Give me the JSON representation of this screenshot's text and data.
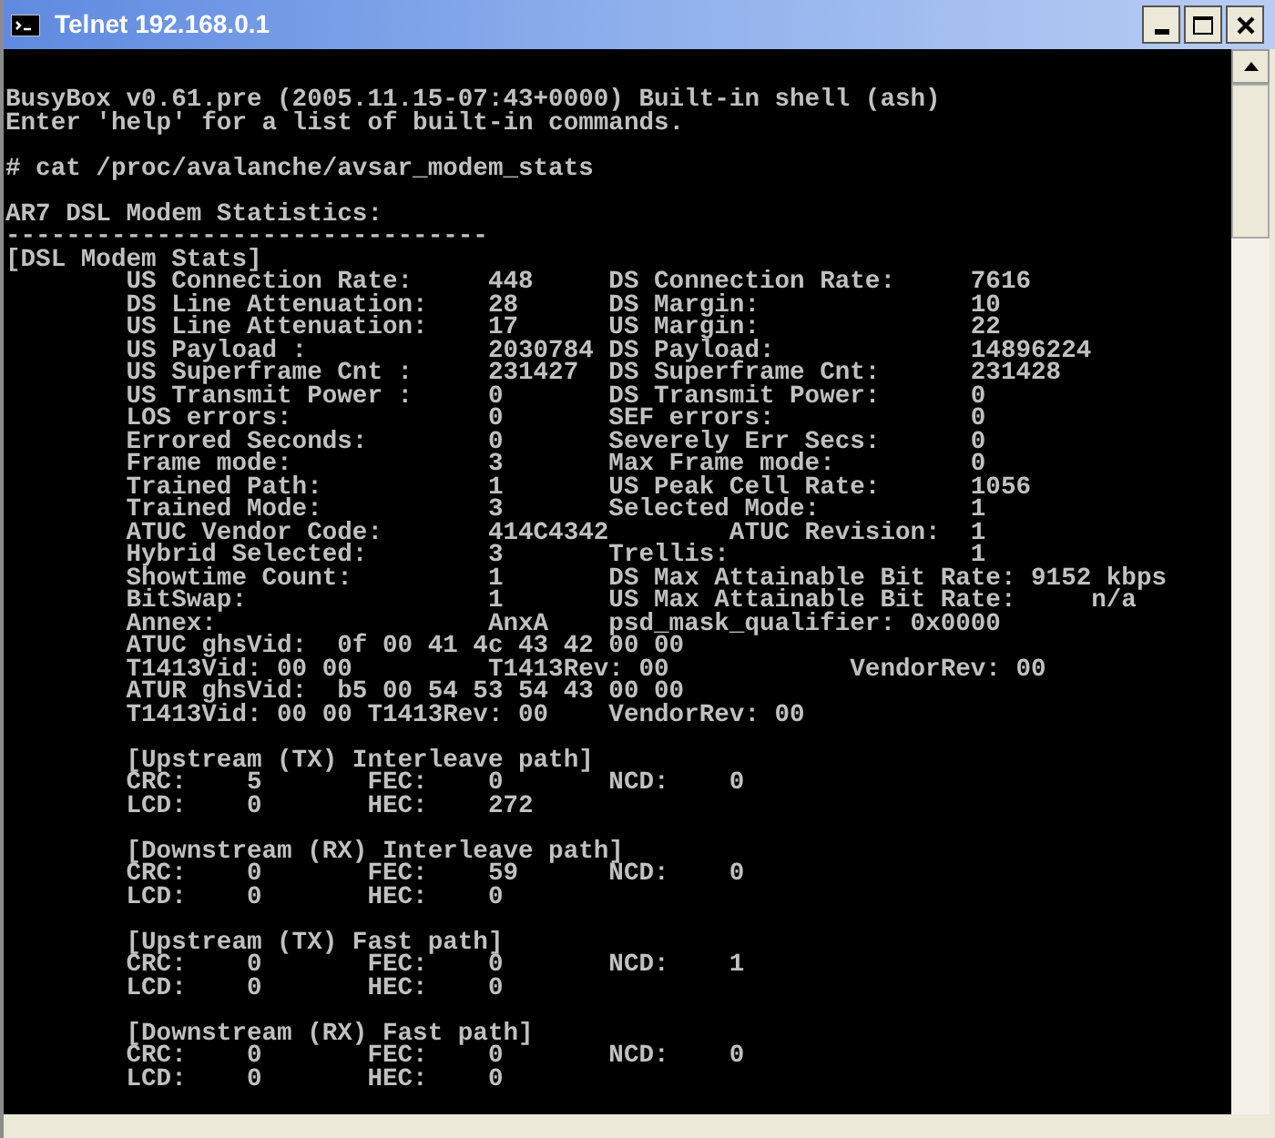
{
  "window": {
    "title": "Telnet 192.168.0.1"
  },
  "console": {
    "blocks": [
      [
        "BusyBox v0.61.pre (2005.11.15-07:43+0000) Built-in shell (ash)",
        "Enter 'help' for a list of built-in commands."
      ],
      [
        "# cat /proc/avalanche/avsar_modem_stats"
      ],
      [
        "AR7 DSL Modem Statistics:",
        "--------------------------------",
        "[DSL Modem Stats]",
        "        US Connection Rate:     448     DS Connection Rate:     7616",
        "        DS Line Attenuation:    28      DS Margin:              10",
        "        US Line Attenuation:    17      US Margin:              22",
        "        US Payload :            2030784 DS Payload:             14896224",
        "        US Superframe Cnt :     231427  DS Superframe Cnt:      231428",
        "        US Transmit Power :     0       DS Transmit Power:      0",
        "        LOS errors:             0       SEF errors:             0",
        "        Errored Seconds:        0       Severely Err Secs:      0",
        "        Frame mode:             3       Max Frame mode:         0",
        "        Trained Path:           1       US Peak Cell Rate:      1056",
        "        Trained Mode:           3       Selected Mode:          1",
        "        ATUC Vendor Code:       414C4342        ATUC Revision:  1",
        "        Hybrid Selected:        3       Trellis:                1",
        "        Showtime Count:         1       DS Max Attainable Bit Rate: 9152 kbps",
        "        BitSwap:                1       US Max Attainable Bit Rate:     n/a",
        "        Annex:                  AnxA    psd_mask_qualifier: 0x0000",
        "        ATUC ghsVid:  0f 00 41 4c 43 42 00 00",
        "        T1413Vid: 00 00         T1413Rev: 00            VendorRev: 00",
        "        ATUR ghsVid:  b5 00 54 53 54 43 00 00",
        "        T1413Vid: 00 00 T1413Rev: 00    VendorRev: 00"
      ],
      [
        "        [Upstream (TX) Interleave path]",
        "        CRC:    5       FEC:    0       NCD:    0",
        "        LCD:    0       HEC:    272"
      ],
      [
        "        [Downstream (RX) Interleave path]",
        "        CRC:    0       FEC:    59      NCD:    0",
        "        LCD:    0       HEC:    0"
      ],
      [
        "        [Upstream (TX) Fast path]",
        "        CRC:    0       FEC:    0       NCD:    1",
        "        LCD:    0       HEC:    0"
      ],
      [
        "        [Downstream (RX) Fast path]",
        "        CRC:    0       FEC:    0       NCD:    0",
        "        LCD:    0       HEC:    0"
      ]
    ]
  }
}
